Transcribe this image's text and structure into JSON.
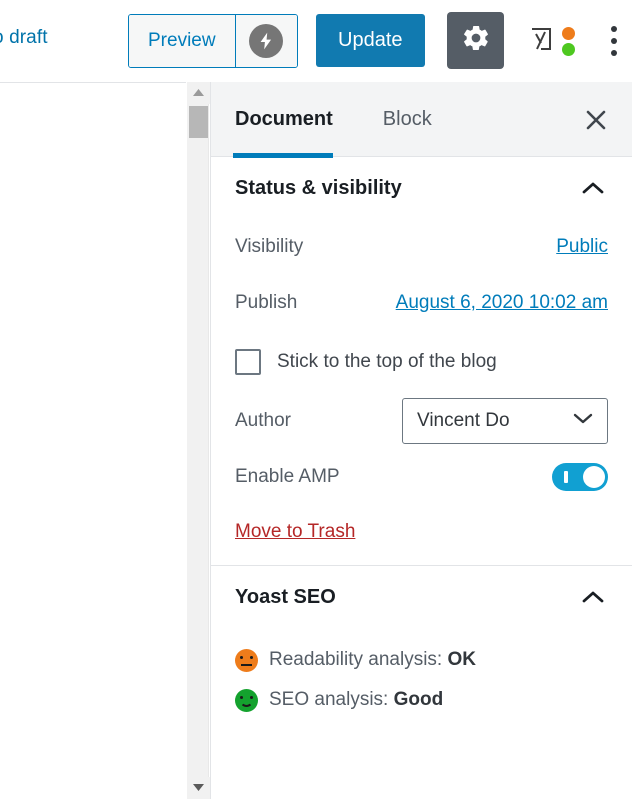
{
  "toolbar": {
    "switch_to_draft_label": "ch to draft",
    "preview_label": "Preview",
    "amp_preview_icon": "lightning-bolt-icon",
    "update_label": "Update",
    "settings_icon": "gear-icon",
    "yoast_icon": "yoast-seo-icon",
    "more_options_icon": "kebab-menu-icon",
    "colors": {
      "update_button": "#117ab0",
      "settings_button": "#555d66",
      "link_blue": "#007cba",
      "yoast_dot_orange": "#ee7c1b",
      "yoast_dot_green": "#4ec820"
    }
  },
  "scrollbar": {
    "up_arrow_icon": "triangle-up-icon",
    "down_arrow_icon": "triangle-down-icon",
    "thumb_position_percent": 3
  },
  "sidebar": {
    "tabs": [
      {
        "label": "Document",
        "active": true
      },
      {
        "label": "Block",
        "active": false
      }
    ],
    "close_icon": "close-icon",
    "panels": [
      {
        "title": "Status & visibility",
        "expanded": true,
        "chevron_icon": "chevron-up-icon",
        "rows": {
          "visibility_label": "Visibility",
          "visibility_value": "Public",
          "publish_label": "Publish",
          "publish_value": "August 6, 2020 10:02 am",
          "sticky_label": "Stick to the top of the blog",
          "sticky_checked": false,
          "author_label": "Author",
          "author_value": "Vincent Do",
          "author_chevron_icon": "chevron-down-icon",
          "amp_label": "Enable AMP",
          "amp_enabled": true,
          "trash_label": "Move to Trash"
        }
      },
      {
        "title": "Yoast SEO",
        "expanded": true,
        "chevron_icon": "chevron-up-icon",
        "analysis": [
          {
            "icon": "neutral-face-icon",
            "color": "#ee7c1b",
            "label": "Readability analysis: ",
            "score": "OK"
          },
          {
            "icon": "smiley-face-icon",
            "color": "#14a22e",
            "label": "SEO analysis: ",
            "score": "Good"
          }
        ]
      }
    ]
  }
}
